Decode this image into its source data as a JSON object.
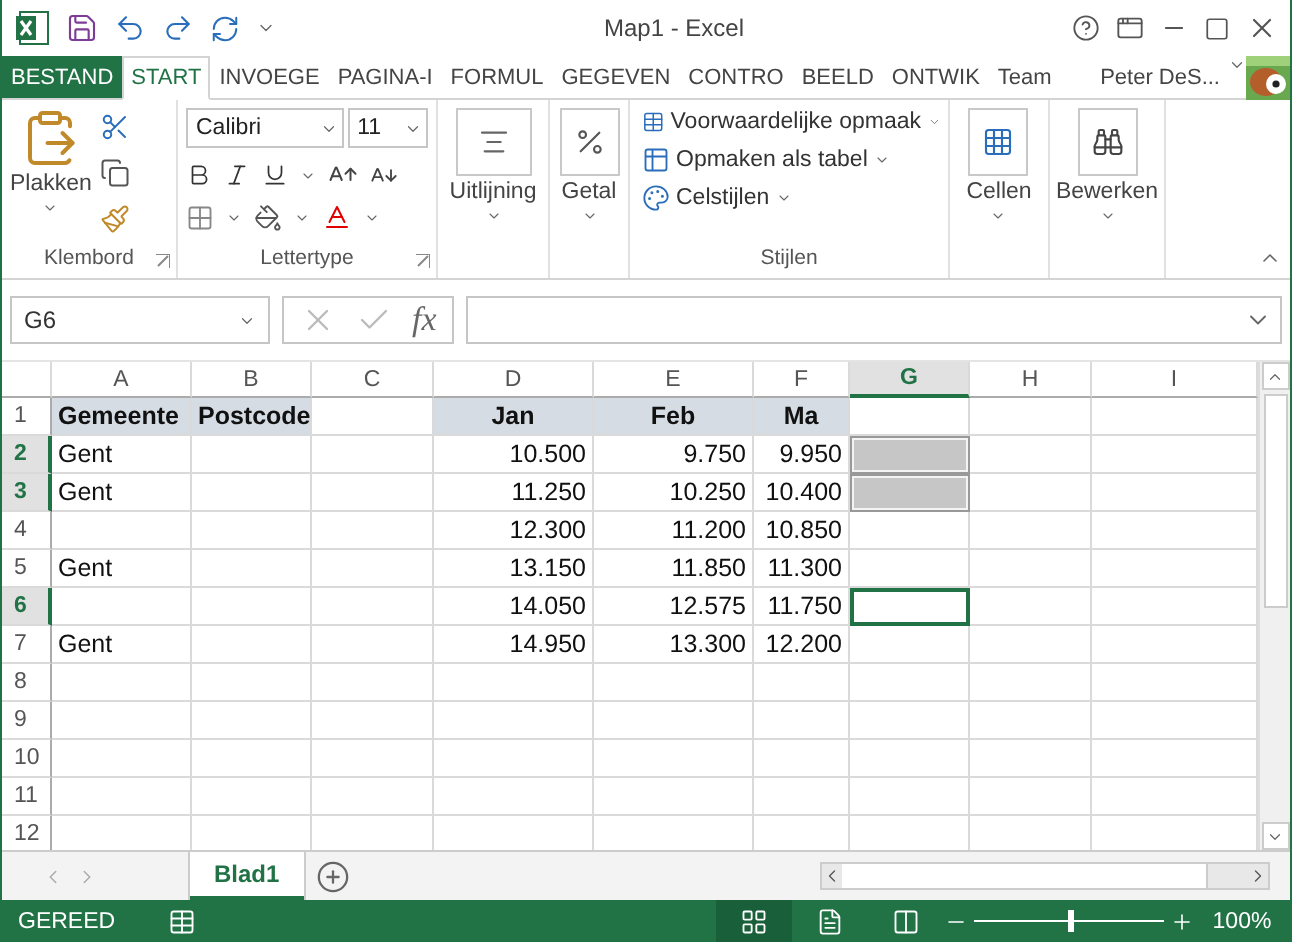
{
  "window": {
    "title": "Map1 - Excel"
  },
  "tabs": [
    {
      "label": "BESTAND",
      "kind": "file",
      "selected": false
    },
    {
      "label": "START",
      "kind": "tab",
      "selected": true
    },
    {
      "label": "INVOEGE",
      "kind": "tab",
      "selected": false
    },
    {
      "label": "PAGINA-I",
      "kind": "tab",
      "selected": false
    },
    {
      "label": "FORMUL",
      "kind": "tab",
      "selected": false
    },
    {
      "label": "GEGEVEN",
      "kind": "tab",
      "selected": false
    },
    {
      "label": "CONTRO",
      "kind": "tab",
      "selected": false
    },
    {
      "label": "BEELD",
      "kind": "tab",
      "selected": false
    },
    {
      "label": "ONTWIK",
      "kind": "tab",
      "selected": false
    },
    {
      "label": "Team",
      "kind": "tab",
      "selected": false
    }
  ],
  "user": {
    "name": "Peter DeS..."
  },
  "ribbon": {
    "clipboard": {
      "label": "Klembord",
      "paste": "Plakken"
    },
    "font": {
      "label": "Lettertype",
      "name": "Calibri",
      "size": "11"
    },
    "alignment": {
      "label": "Uitlijning"
    },
    "number": {
      "label": "Getal"
    },
    "styles": {
      "label": "Stijlen",
      "items": [
        "Voorwaardelijke opmaak",
        "Opmaken als tabel",
        "Celstijlen"
      ]
    },
    "cells": {
      "label": "Cellen"
    },
    "editing": {
      "label": "Bewerken"
    }
  },
  "formula_bar": {
    "name_box": "G6",
    "function_label": "fx"
  },
  "columns": [
    {
      "label": "A",
      "selected": false
    },
    {
      "label": "B",
      "selected": false
    },
    {
      "label": "C",
      "selected": false
    },
    {
      "label": "D",
      "selected": false
    },
    {
      "label": "E",
      "selected": false
    },
    {
      "label": "F",
      "selected": false
    },
    {
      "label": "G",
      "selected": true
    },
    {
      "label": "H",
      "selected": false
    },
    {
      "label": "I",
      "selected": false
    }
  ],
  "rows": [
    {
      "header": "1",
      "selected": false,
      "cells": [
        {
          "kind": "label_heading",
          "text": "Gemeente"
        },
        {
          "kind": "label_heading",
          "text": "Postcode"
        },
        {
          "kind": "empty"
        },
        {
          "kind": "value_heading",
          "text": "Jan"
        },
        {
          "kind": "value_heading",
          "text": "Feb"
        },
        {
          "kind": "value_heading",
          "text": "Ma"
        },
        {
          "kind": "empty"
        }
      ]
    },
    {
      "header": "2",
      "selected": true,
      "cells": [
        {
          "kind": "text",
          "text": "Gent"
        },
        {
          "kind": "empty"
        },
        {
          "kind": "empty"
        },
        {
          "kind": "number",
          "text": "10.500"
        },
        {
          "kind": "number",
          "text": "9.750"
        },
        {
          "kind": "number",
          "text": "9.950"
        },
        {
          "kind": "filled"
        }
      ]
    },
    {
      "header": "3",
      "selected": true,
      "cells": [
        {
          "kind": "text",
          "text": "Gent"
        },
        {
          "kind": "empty"
        },
        {
          "kind": "empty"
        },
        {
          "kind": "number",
          "text": "11.250"
        },
        {
          "kind": "number",
          "text": "10.250"
        },
        {
          "kind": "number",
          "text": "10.400"
        },
        {
          "kind": "filled"
        }
      ]
    },
    {
      "header": "4",
      "selected": false,
      "cells": [
        {
          "kind": "empty"
        },
        {
          "kind": "empty"
        },
        {
          "kind": "empty"
        },
        {
          "kind": "number",
          "text": "12.300"
        },
        {
          "kind": "number",
          "text": "11.200"
        },
        {
          "kind": "number",
          "text": "10.850"
        },
        {
          "kind": "empty"
        }
      ]
    },
    {
      "header": "5",
      "selected": false,
      "cells": [
        {
          "kind": "text",
          "text": "Gent"
        },
        {
          "kind": "empty"
        },
        {
          "kind": "empty"
        },
        {
          "kind": "number",
          "text": "13.150"
        },
        {
          "kind": "number",
          "text": "11.850"
        },
        {
          "kind": "number",
          "text": "11.300"
        },
        {
          "kind": "empty"
        }
      ]
    },
    {
      "header": "6",
      "selected": true,
      "cells": [
        {
          "kind": "empty"
        },
        {
          "kind": "empty"
        },
        {
          "kind": "empty"
        },
        {
          "kind": "number",
          "text": "14.050"
        },
        {
          "kind": "number",
          "text": "12.575"
        },
        {
          "kind": "number",
          "text": "11.750"
        },
        {
          "kind": "active"
        }
      ]
    },
    {
      "header": "7",
      "selected": false,
      "cells": [
        {
          "kind": "text",
          "text": "Gent"
        },
        {
          "kind": "empty"
        },
        {
          "kind": "empty"
        },
        {
          "kind": "number",
          "text": "14.950"
        },
        {
          "kind": "number",
          "text": "13.300"
        },
        {
          "kind": "number",
          "text": "12.200"
        },
        {
          "kind": "empty"
        }
      ]
    },
    {
      "header": "8",
      "selected": false,
      "cells": []
    },
    {
      "header": "9",
      "selected": false,
      "cells": []
    },
    {
      "header": "10",
      "selected": false,
      "cells": []
    },
    {
      "header": "11",
      "selected": false,
      "cells": []
    },
    {
      "header": "12",
      "selected": false,
      "cells": []
    }
  ],
  "sheets": [
    {
      "label": "Blad1",
      "selected": true
    }
  ],
  "status_bar": {
    "status": "GEREED",
    "zoom": "100%",
    "zoom_level": {
      "level": 0.5
    }
  }
}
